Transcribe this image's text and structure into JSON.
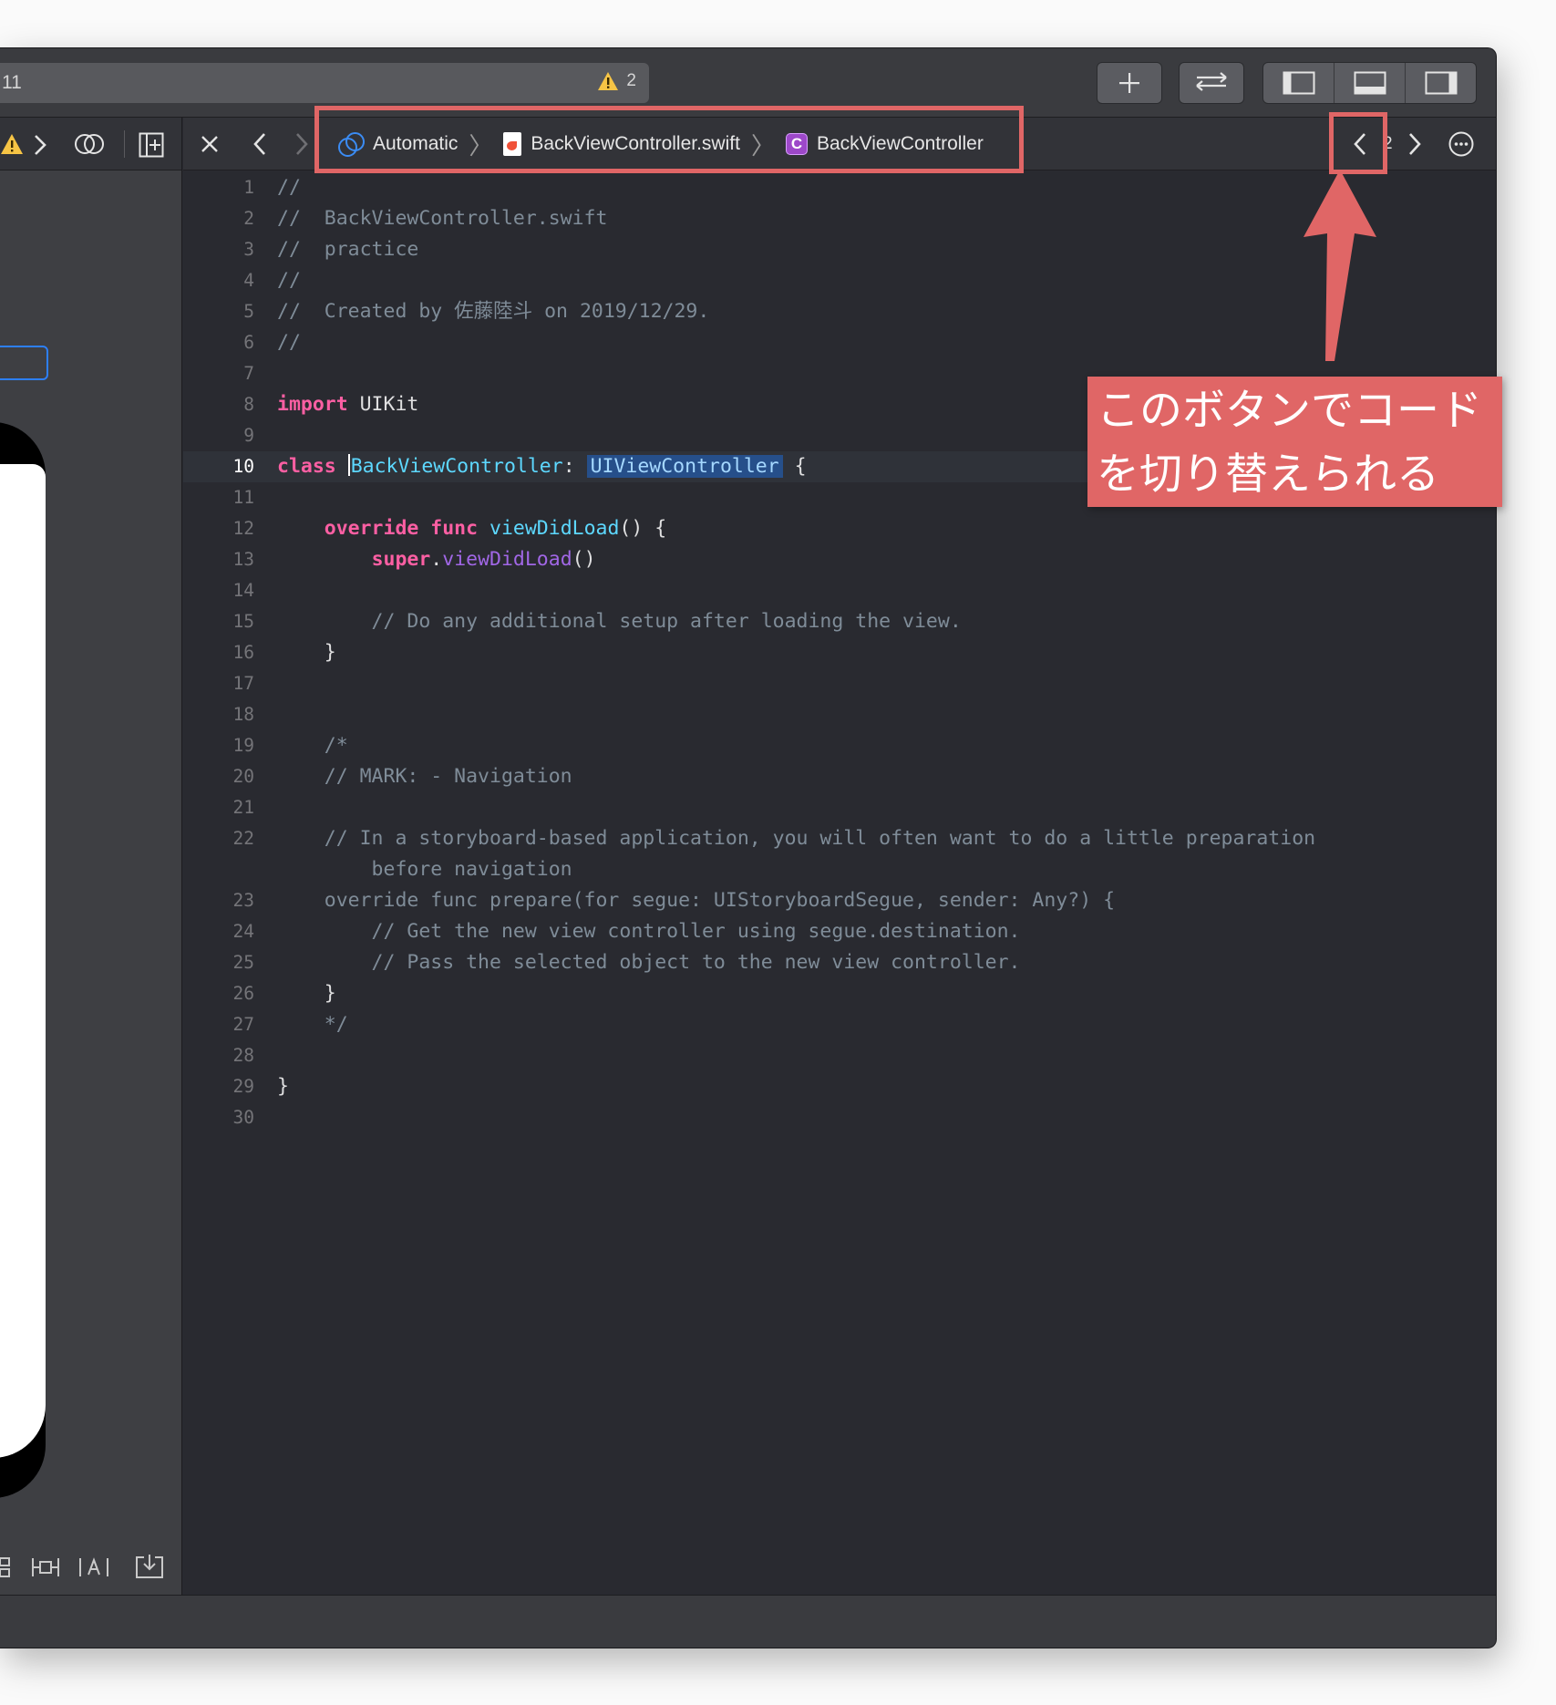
{
  "toolbar": {
    "scheme_fragment": "11",
    "warning_count": "2",
    "add_label": "+",
    "swap_label": "⇄"
  },
  "jumpbar": {
    "close": "×",
    "back": "‹",
    "forward": "›",
    "crumbs": [
      "Automatic",
      "BackViewController.swift",
      "BackViewController"
    ],
    "class_badge": "C",
    "counterpart_fragment": "2",
    "options": "⋯"
  },
  "code_lines": [
    {
      "n": "1",
      "text": "//"
    },
    {
      "n": "2",
      "text": "//  BackViewController.swift"
    },
    {
      "n": "3",
      "text": "//  practice"
    },
    {
      "n": "4",
      "text": "//"
    },
    {
      "n": "5",
      "text": "//  Created by 佐藤陸斗 on 2019/12/29."
    },
    {
      "n": "6",
      "text": "//"
    },
    {
      "n": "7",
      "text": ""
    },
    {
      "n": "8",
      "kw": "import",
      "rest": " UIKit"
    },
    {
      "n": "9",
      "text": ""
    },
    {
      "n": "10",
      "kw": "class",
      "name": "BackViewController",
      "colon": ":",
      "super": "UIViewController",
      "brace": " {"
    },
    {
      "n": "11",
      "text": ""
    },
    {
      "n": "12",
      "kw1": "override",
      "kw2": "func",
      "fn": "viewDidLoad",
      "rest": "() {"
    },
    {
      "n": "13",
      "kw": "super",
      "dot": ".",
      "method": "viewDidLoad",
      "rest": "()"
    },
    {
      "n": "14",
      "text": ""
    },
    {
      "n": "15",
      "text": "        // Do any additional setup after loading the view."
    },
    {
      "n": "16",
      "text": "    }"
    },
    {
      "n": "17",
      "text": ""
    },
    {
      "n": "18",
      "text": ""
    },
    {
      "n": "19",
      "text": "    /*"
    },
    {
      "n": "20",
      "text": "    // MARK: - Navigation"
    },
    {
      "n": "21",
      "text": ""
    },
    {
      "n": "22",
      "text": "    // In a storyboard-based application, you will often want to do a little preparation"
    },
    {
      "n": "",
      "text": "        before navigation"
    },
    {
      "n": "23",
      "text": "    override func prepare(for segue: UIStoryboardSegue, sender: Any?) {"
    },
    {
      "n": "24",
      "text": "        // Get the new view controller using segue.destination."
    },
    {
      "n": "25",
      "text": "        // Pass the selected object to the new view controller."
    },
    {
      "n": "26",
      "text": "    }"
    },
    {
      "n": "27",
      "text": "    */"
    },
    {
      "n": "28",
      "text": ""
    },
    {
      "n": "29",
      "text": "}"
    },
    {
      "n": "30",
      "text": ""
    }
  ],
  "annotation": {
    "callout_text": "このボタンでコード\nを切り替えられる",
    "color": "#e06666"
  },
  "colors": {
    "editor_bg": "#292a30",
    "keyword": "#fc5fa3",
    "comment": "#7f8c98",
    "type": "#5dd8ff"
  }
}
